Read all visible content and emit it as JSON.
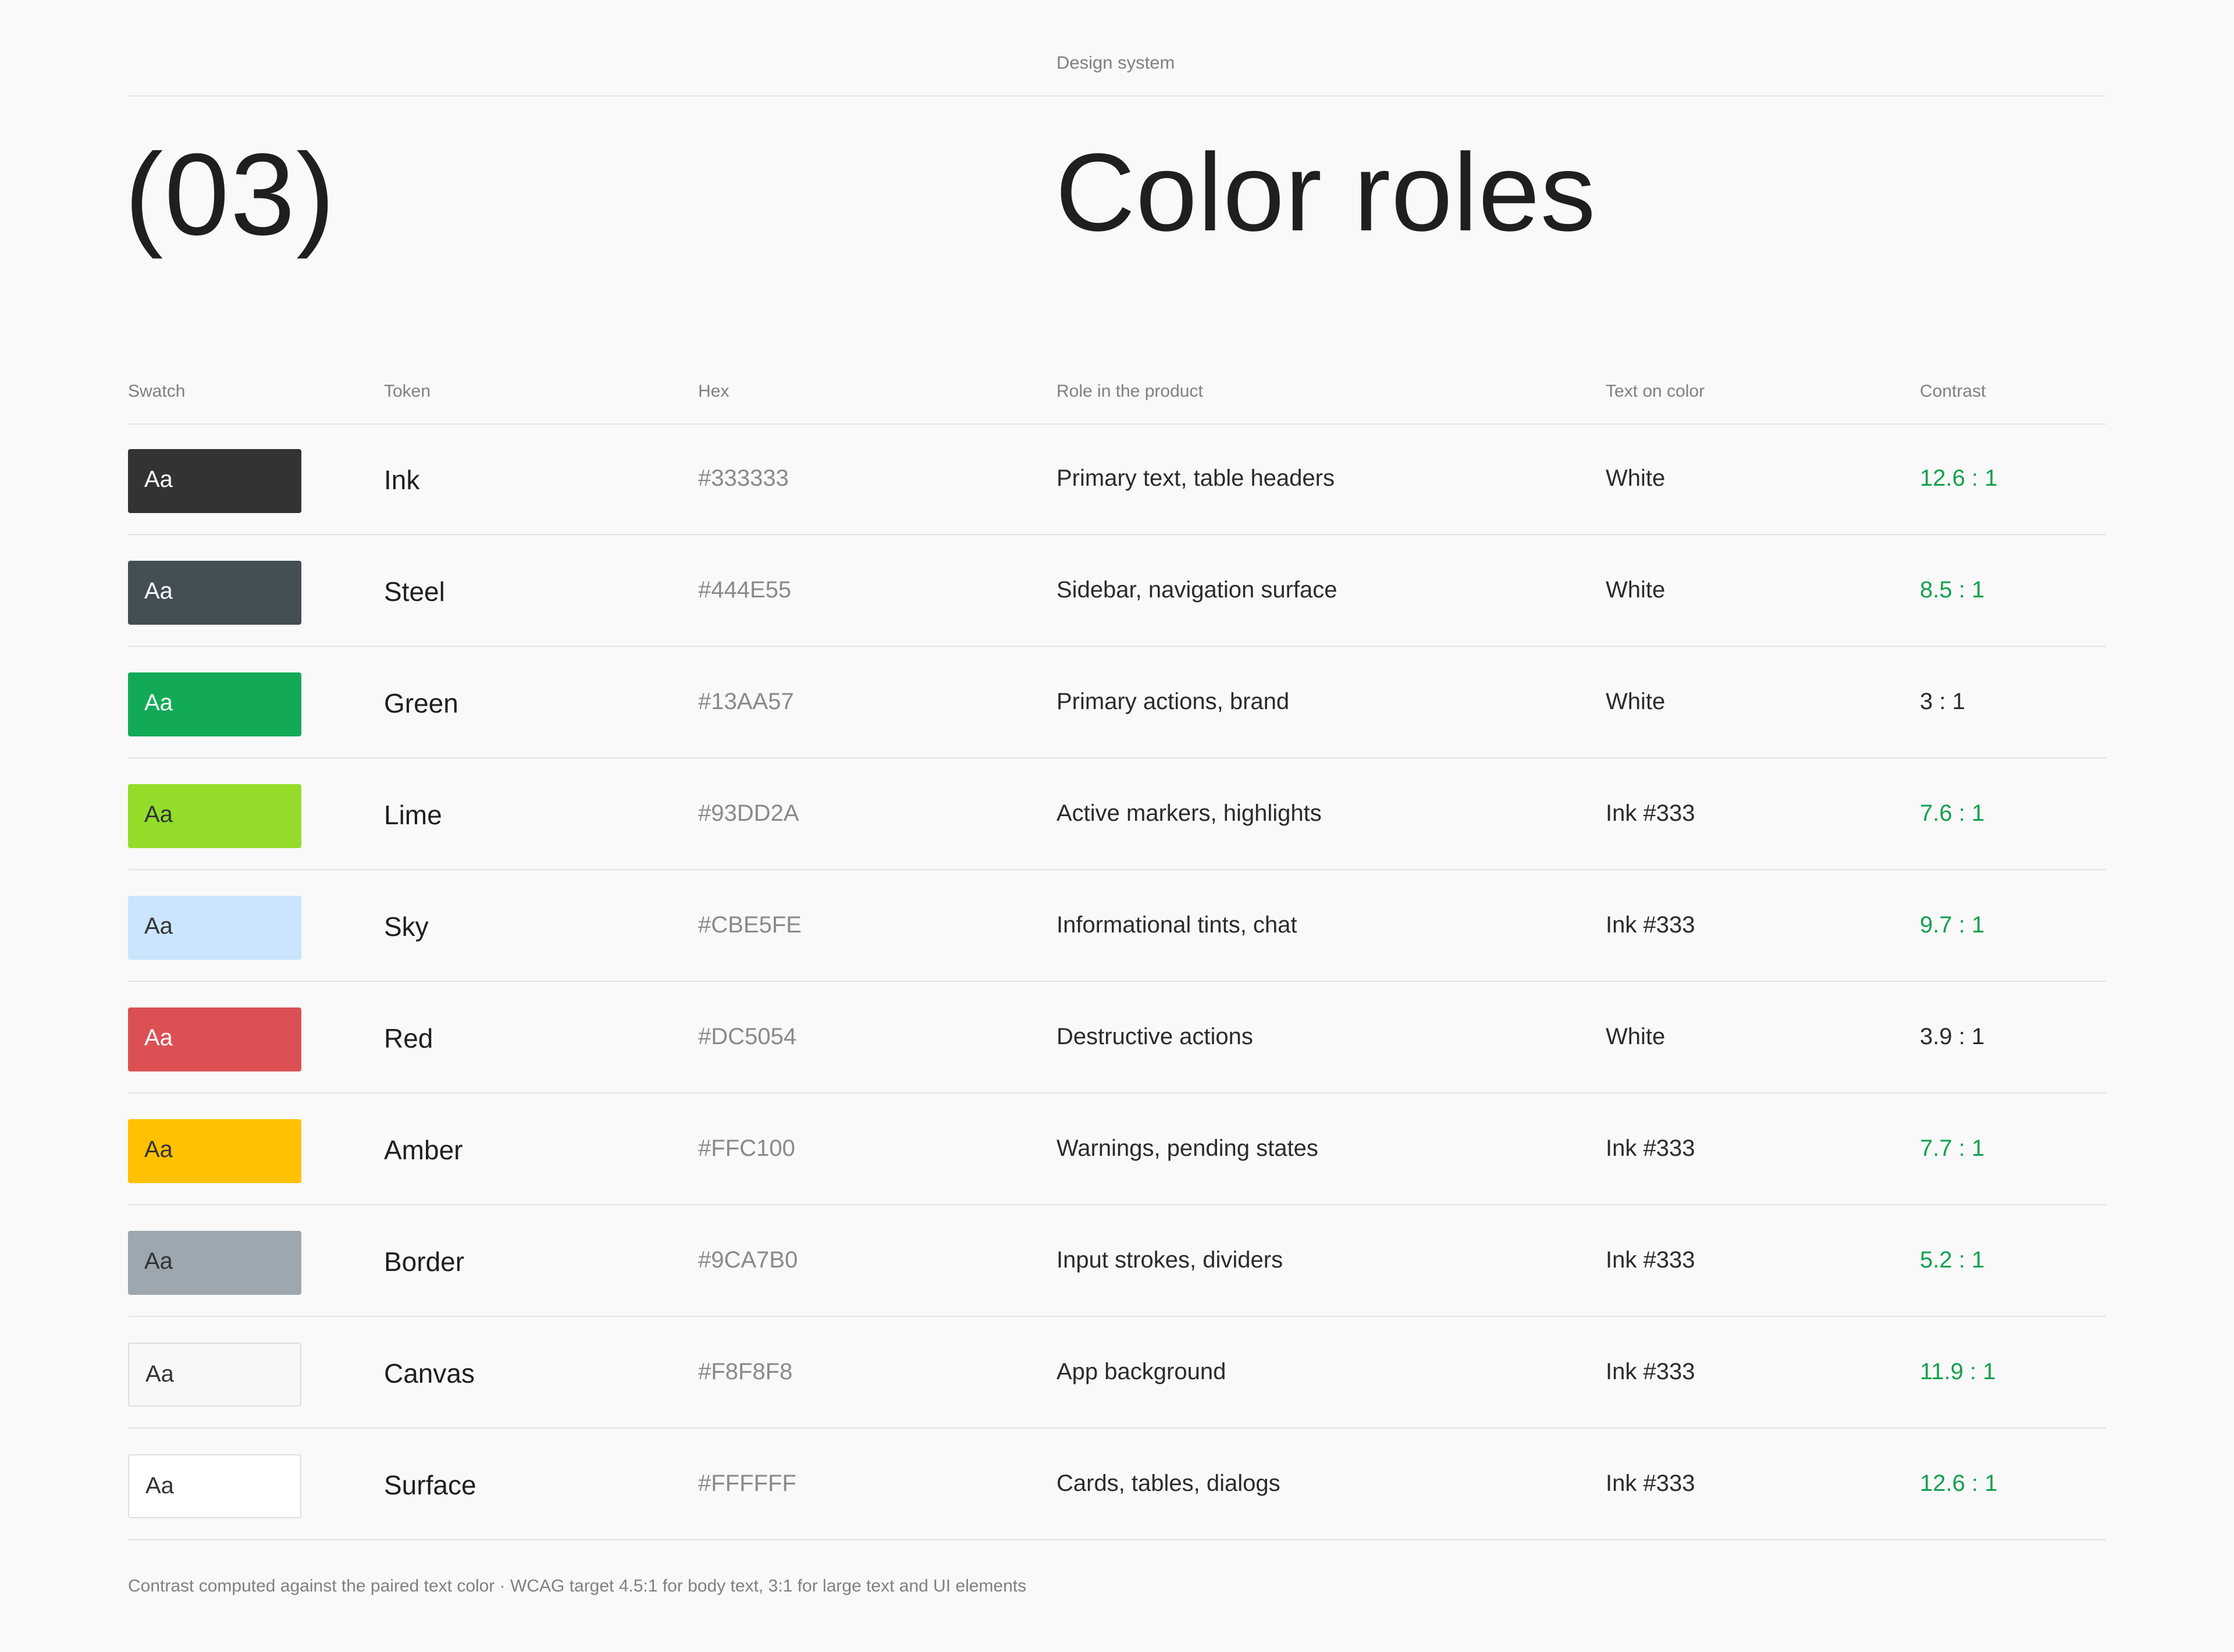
{
  "header": {
    "eyebrow": "Design system",
    "section_number": "(03)",
    "title": "Color roles"
  },
  "table": {
    "columns": [
      "Swatch",
      "Token",
      "Hex",
      "Role in the product",
      "Text on color",
      "Contrast"
    ],
    "rows": [
      {
        "sample": "Aa",
        "color": "#333333",
        "text_color": "#FFFFFF",
        "token": "Ink",
        "hex": "#333333",
        "role": "Primary text, table headers",
        "text_on": "White",
        "contrast": "12.6 : 1",
        "pass": true
      },
      {
        "sample": "Aa",
        "color": "#444E55",
        "text_color": "#FFFFFF",
        "token": "Steel",
        "hex": "#444E55",
        "role": "Sidebar, navigation surface",
        "text_on": "White",
        "contrast": "8.5 : 1",
        "pass": true
      },
      {
        "sample": "Aa",
        "color": "#13AA57",
        "text_color": "#FFFFFF",
        "token": "Green",
        "hex": "#13AA57",
        "role": "Primary actions, brand",
        "text_on": "White",
        "contrast": "3 : 1",
        "pass": false
      },
      {
        "sample": "Aa",
        "color": "#93DD2A",
        "text_color": "#333333",
        "token": "Lime",
        "hex": "#93DD2A",
        "role": "Active markers, highlights",
        "text_on": "Ink #333",
        "contrast": "7.6 : 1",
        "pass": true
      },
      {
        "sample": "Aa",
        "color": "#CBE5FE",
        "text_color": "#333333",
        "token": "Sky",
        "hex": "#CBE5FE",
        "role": "Informational tints, chat",
        "text_on": "Ink #333",
        "contrast": "9.7 : 1",
        "pass": true
      },
      {
        "sample": "Aa",
        "color": "#DC5054",
        "text_color": "#FFFFFF",
        "token": "Red",
        "hex": "#DC5054",
        "role": "Destructive actions",
        "text_on": "White",
        "contrast": "3.9 : 1",
        "pass": false
      },
      {
        "sample": "Aa",
        "color": "#FFC100",
        "text_color": "#333333",
        "token": "Amber",
        "hex": "#FFC100",
        "role": "Warnings, pending states",
        "text_on": "Ink #333",
        "contrast": "7.7 : 1",
        "pass": true
      },
      {
        "sample": "Aa",
        "color": "#9CA7B0",
        "text_color": "#333333",
        "token": "Border",
        "hex": "#9CA7B0",
        "role": "Input strokes, dividers",
        "text_on": "Ink #333",
        "contrast": "5.2 : 1",
        "pass": true
      },
      {
        "sample": "Aa",
        "color": "#F8F8F8",
        "text_color": "#333333",
        "token": "Canvas",
        "hex": "#F8F8F8",
        "role": "App background",
        "text_on": "Ink #333",
        "contrast": "11.9 : 1",
        "pass": true
      },
      {
        "sample": "Aa",
        "color": "#FFFFFF",
        "text_color": "#333333",
        "token": "Surface",
        "hex": "#FFFFFF",
        "role": "Cards, tables, dialogs",
        "text_on": "Ink #333",
        "contrast": "12.6 : 1",
        "pass": true
      }
    ]
  },
  "footnote": "Contrast computed against the paired text color · WCAG target 4.5:1 for body text, 3:1 for large text and UI elements"
}
